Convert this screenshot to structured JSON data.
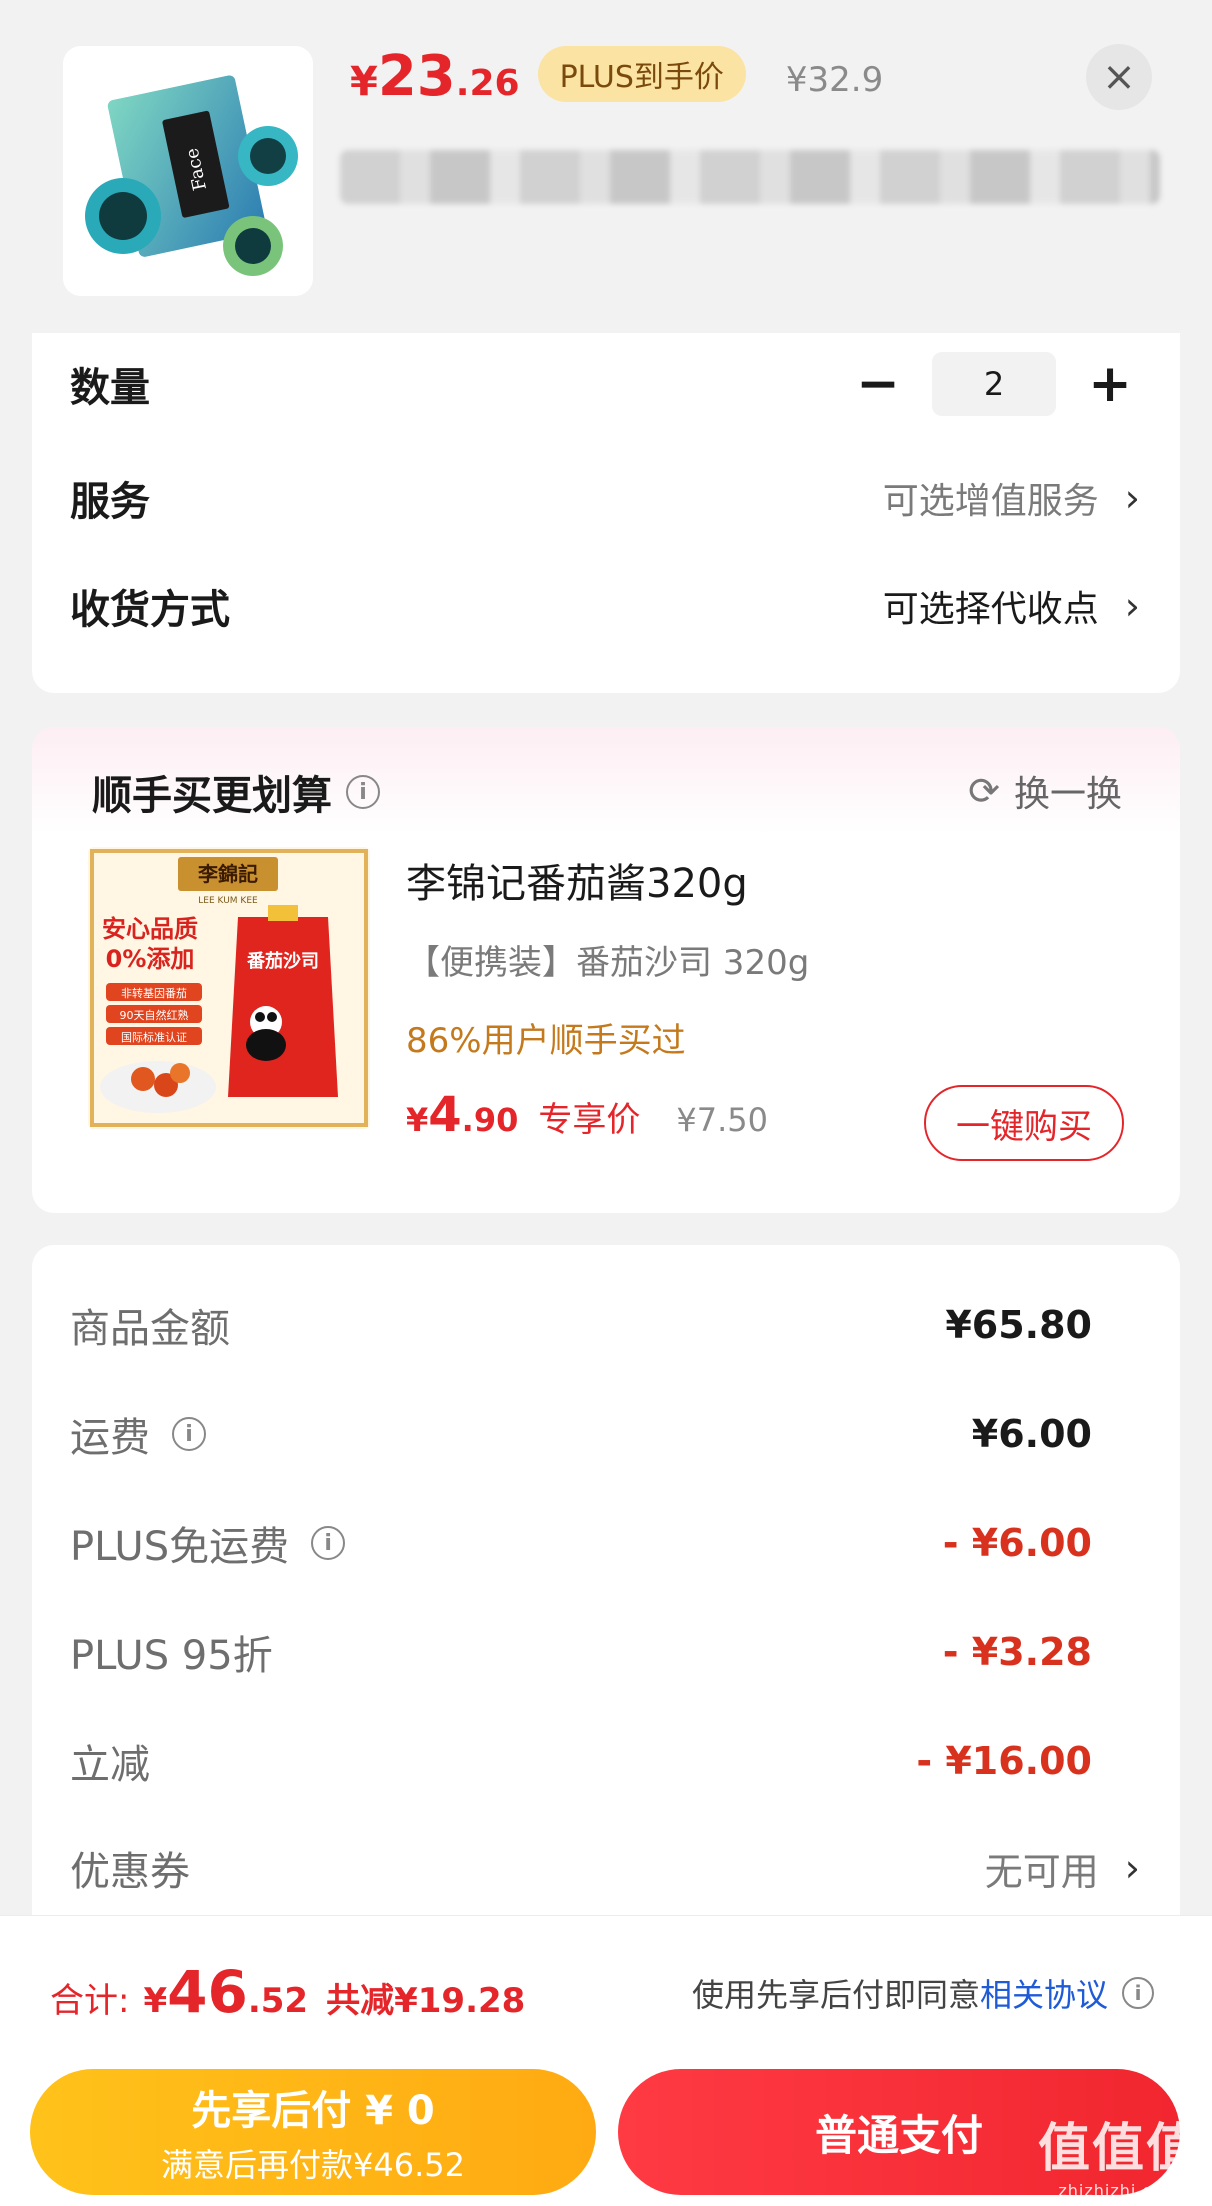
{
  "product": {
    "price_symbol": "¥",
    "price_int": "23",
    "price_dec": ".26",
    "plus_tag": "PLUS到手价",
    "original_price": "¥32.9"
  },
  "options": {
    "quantity_label": "数量",
    "quantity_value": "2",
    "minus": "−",
    "plus": "+",
    "service_label": "服务",
    "service_value": "可选增值服务",
    "delivery_label": "收货方式",
    "delivery_value": "可选择代收点",
    "chevron": "›"
  },
  "addon": {
    "title": "顺手买更划算",
    "swap_label": "换一换",
    "name": "李锦记番茄酱320g",
    "spec": "【便携装】番茄沙司 320g",
    "social": "86%用户顺手买过",
    "price_symbol": "¥",
    "price_int": "4",
    "price_dec": ".90",
    "price_tag": "专享价",
    "original_price": "¥7.50",
    "buy_label": "一键购买",
    "image_text": {
      "brand": "李錦記",
      "brand_en": "LEE KUM KEE",
      "line1": "安心品质",
      "line2": "0%添加",
      "tag1": "非转基因番茄",
      "tag2": "90天自然红熟",
      "tag3": "国际标准认证",
      "pouch": "番茄沙司"
    }
  },
  "summary": {
    "rows": [
      {
        "label": "商品金额",
        "value": "¥65.80"
      },
      {
        "label": "运费",
        "value": "¥6.00"
      },
      {
        "label": "PLUS免运费",
        "value": "- ¥6.00"
      },
      {
        "label": "PLUS 95折",
        "value": "- ¥3.28"
      },
      {
        "label": "立减",
        "value": "- ¥16.00"
      },
      {
        "label": "优惠券",
        "value": "无可用"
      }
    ]
  },
  "footer": {
    "total_label": "合计:",
    "total_symbol": "¥",
    "total_int": "46",
    "total_dec": ".52",
    "total_saved": "共减¥19.28",
    "agree_text": "使用先享后付即同意",
    "agree_link": "相关协议",
    "later_line1": "先享后付 ¥ 0",
    "later_line2": "满意后再付款¥46.52",
    "pay_label": "普通支付"
  },
  "watermark": {
    "main": "值值值",
    "sub": "zhizhizhi.com"
  },
  "colors": {
    "accent_red": "#e4252a",
    "discount_red": "#d8321f",
    "plus_gold": "#fbe3a3",
    "pay_later_yellow": "#ffb414",
    "link_blue": "#1f5bd6"
  }
}
